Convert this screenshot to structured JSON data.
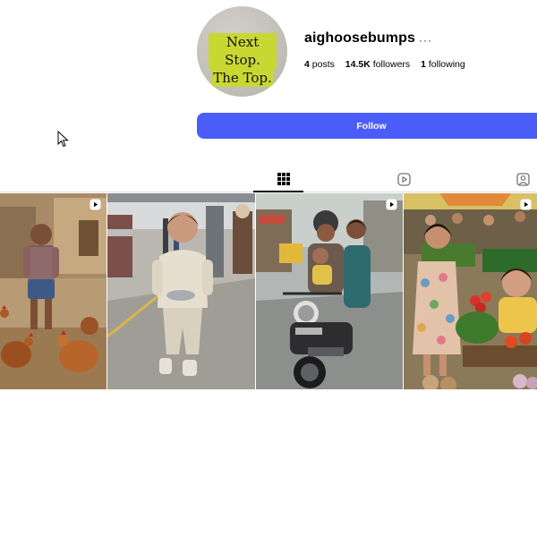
{
  "profile": {
    "avatar_text_line1": "Next Stop.",
    "avatar_text_line2": "The Top.",
    "username": "aighoosebumps",
    "more_label": "···",
    "stats": {
      "posts_value": "4",
      "posts_label": "posts",
      "followers_value": "14.5K",
      "followers_label": "followers",
      "following_value": "1",
      "following_label": "following"
    },
    "follow_label": "Follow"
  },
  "tabs": [
    {
      "icon": "grid-icon",
      "active": true
    },
    {
      "icon": "reels-icon",
      "active": false
    },
    {
      "icon": "tagged-icon",
      "active": false
    }
  ],
  "posts": [
    {
      "type": "reel",
      "subject": "toddler with chickens"
    },
    {
      "type": "reel",
      "subject": "toddler on railway platform"
    },
    {
      "type": "reel",
      "subject": "family on motorcycle"
    },
    {
      "type": "reel",
      "subject": "toddlers at vegetable market"
    }
  ],
  "colors": {
    "follow_button": "#4a5df9",
    "tab_active": "#000000",
    "divider": "#dbdbdb"
  }
}
